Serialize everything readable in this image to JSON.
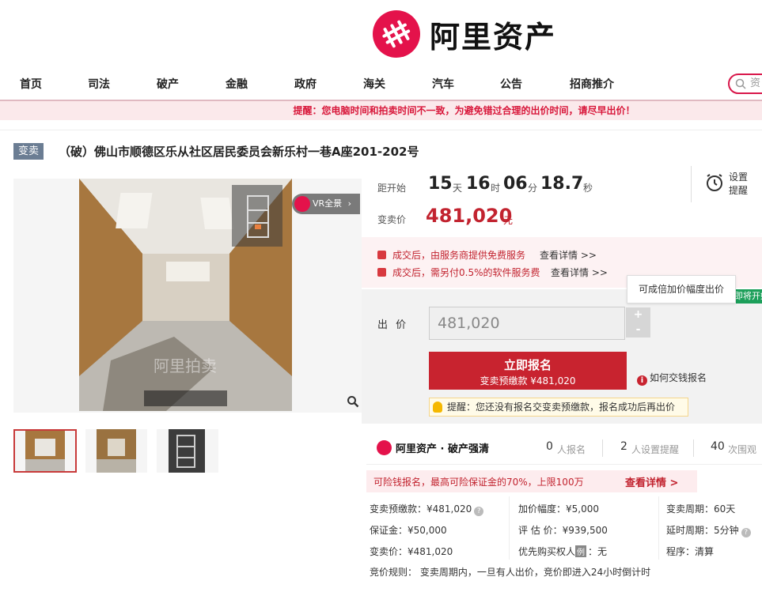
{
  "brand": {
    "name": "阿里资产"
  },
  "nav": {
    "items": [
      "首页",
      "司法",
      "破产",
      "金融",
      "政府",
      "海关",
      "汽车",
      "公告",
      "招商推介"
    ],
    "search_placeholder": "资"
  },
  "notice": "提醒：您电脑时间和拍卖时间不一致，为避免错过合理的出价时间，请尽早出价！",
  "listing": {
    "badge": "变卖",
    "title": "（破）佛山市顺德区乐从社区居民委员会新乐村一巷A座201-202号"
  },
  "gallery": {
    "vr_label": "VR全景",
    "watermark": "阿里拍卖",
    "thumb_count": 3
  },
  "countdown": {
    "label": "距开始",
    "days": "15",
    "days_unit": "天",
    "hours": "16",
    "hours_unit": "时",
    "minutes": "06",
    "minutes_unit": "分",
    "seconds": "18.7",
    "seconds_unit": "秒",
    "remind_label": "设置提醒"
  },
  "price": {
    "label": "变卖价",
    "value": "481,020",
    "unit": "元"
  },
  "services": [
    {
      "text": "成交后，由服务商提供免费服务",
      "link": "查看详情 >>"
    },
    {
      "text": "成交后，需另付0.5%的软件服务费",
      "link": "查看详情 >>"
    }
  ],
  "bid": {
    "label": "出 价",
    "value": "481,020",
    "plus": "+",
    "minus": "-",
    "tooltip": "可成倍加价幅度出价",
    "start_tag": "即将开始",
    "signup_main": "立即报名",
    "signup_sub": "变卖预缴款 ¥481,020",
    "how_pay": "如何交钱报名",
    "hint": "提醒：您还没有报名交变卖预缴款，报名成功后再出价"
  },
  "brand2": {
    "name": "阿里资产 · 破产强清"
  },
  "stats": [
    {
      "num": "0",
      "label": "人报名"
    },
    {
      "num": "2",
      "label": "人设置提醒"
    },
    {
      "num": "40",
      "label": "次围观"
    }
  ],
  "deposit": {
    "text": "可险钱报名，最高可险保证金的70%，上限100万",
    "link": "查看详情 >"
  },
  "details": {
    "r1c1": "变卖预缴款：¥481,020",
    "r1c2": "加价幅度：¥5,000",
    "r1c3": "变卖周期：60天",
    "r2c1": "保证金：¥50,000",
    "r2c2": "评 估 价：¥939,500",
    "r2c3": "延时周期：5分钟",
    "r3c1": "变卖价：¥481,020",
    "r3c2_label": "优先购买权人",
    "r3c2_tag": "例",
    "r3c2_val": "：无",
    "r3c3": "程序：清算",
    "rule": "竞价规则：  变卖周期内，一旦有人出价，竞价即进入24小时倒计时"
  },
  "colors": {
    "brand": "#e4124b",
    "accent": "#c8232f",
    "green": "#1c9f5a"
  }
}
